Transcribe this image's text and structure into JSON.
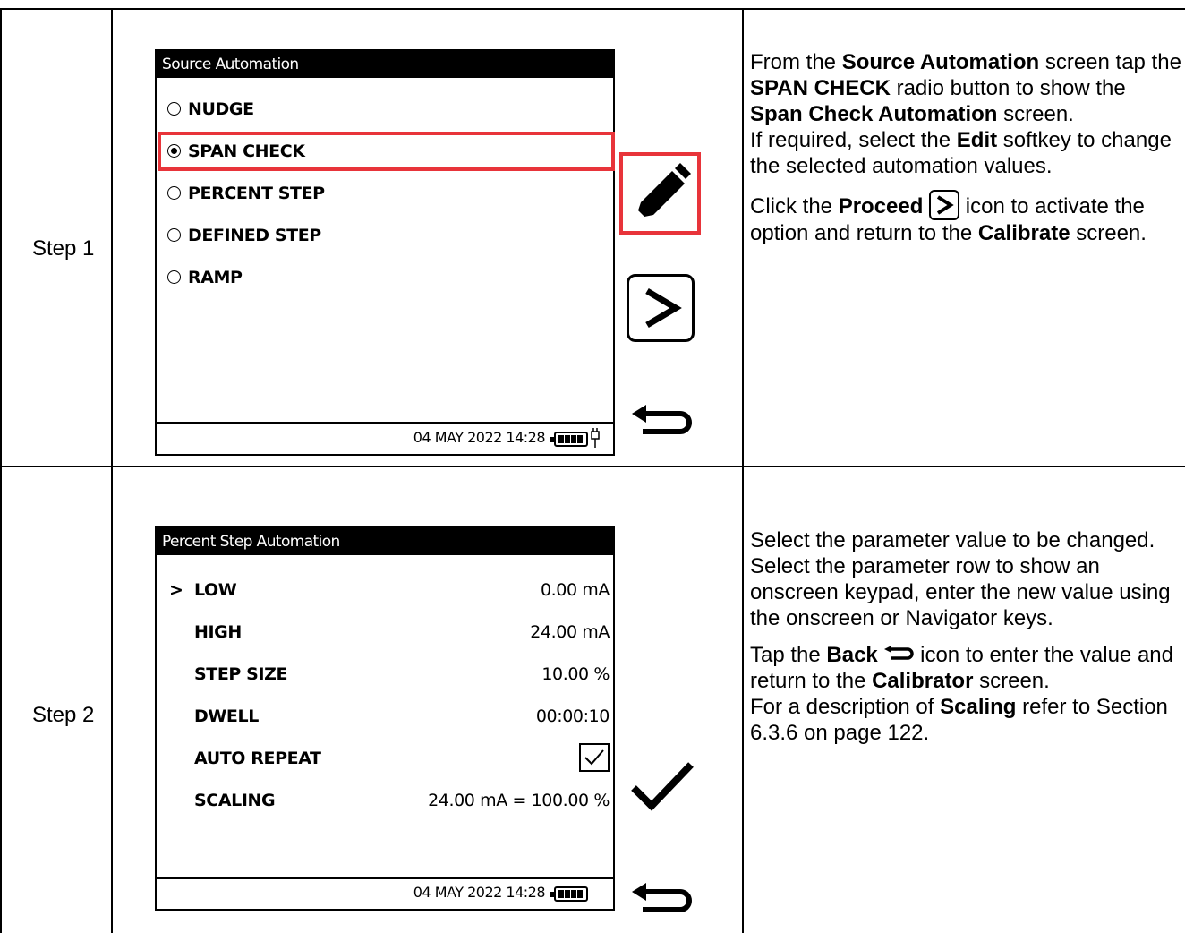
{
  "rows": [
    {
      "step_label": "Step 1",
      "screen": {
        "title": "Source Automation",
        "options": [
          {
            "label": "NUDGE",
            "selected": false
          },
          {
            "label": "SPAN CHECK",
            "selected": true
          },
          {
            "label": "PERCENT STEP",
            "selected": false
          },
          {
            "label": "DEFINED STEP",
            "selected": false
          },
          {
            "label": "RAMP",
            "selected": false
          }
        ],
        "datetime": "04 MAY 2022 14:28"
      },
      "softkeys": [
        "edit-icon",
        "proceed-icon",
        "back-icon"
      ],
      "description": {
        "p1_a": "From the ",
        "p1_b": "Source Automation",
        "p1_c": " screen tap the ",
        "p1_d": "SPAN CHECK",
        "p1_e": " radio button to show the ",
        "p1_f": "Span Check Automation",
        "p1_g": " screen.",
        "p2_a": "If required, select the ",
        "p2_b": "Edit",
        "p2_c": " softkey to change the selected automation values.",
        "p3_a": "Click the ",
        "p3_b": "Proceed",
        "p3_c": " icon to activate the option and return to the ",
        "p3_d": "Calibrate",
        "p3_e": " screen."
      }
    },
    {
      "step_label": "Step 2",
      "screen": {
        "title": "Percent Step Automation",
        "cursor": ">",
        "params": [
          {
            "name": "LOW",
            "value": "0.00 mA"
          },
          {
            "name": "HIGH",
            "value": "24.00 mA"
          },
          {
            "name": "STEP SIZE",
            "value": "10.00 %"
          },
          {
            "name": "DWELL",
            "value": "00:00:10"
          },
          {
            "name": "AUTO REPEAT",
            "value": ""
          },
          {
            "name": "SCALING",
            "value": "24.00 mA = 100.00 %"
          }
        ],
        "auto_repeat_checked": true,
        "datetime": "04 MAY 2022 14:28"
      },
      "softkeys": [
        "check-icon",
        "back-icon"
      ],
      "description": {
        "p1": "Select the parameter value to be changed.",
        "p2": "Select the parameter row to show an onscreen keypad, enter the new value using the onscreen or Navigator keys.",
        "p3_a": "Tap the ",
        "p3_b": "Back",
        "p3_c": " icon to enter the value and return to the ",
        "p3_d": "Calibrator",
        "p3_e": " screen.",
        "p4_a": "For a description of ",
        "p4_b": "Scaling",
        "p4_c": " refer to Section 6.3.6 on page 122."
      }
    }
  ],
  "colors": {
    "highlight": "#e8343a",
    "titlebar": "#000000"
  }
}
